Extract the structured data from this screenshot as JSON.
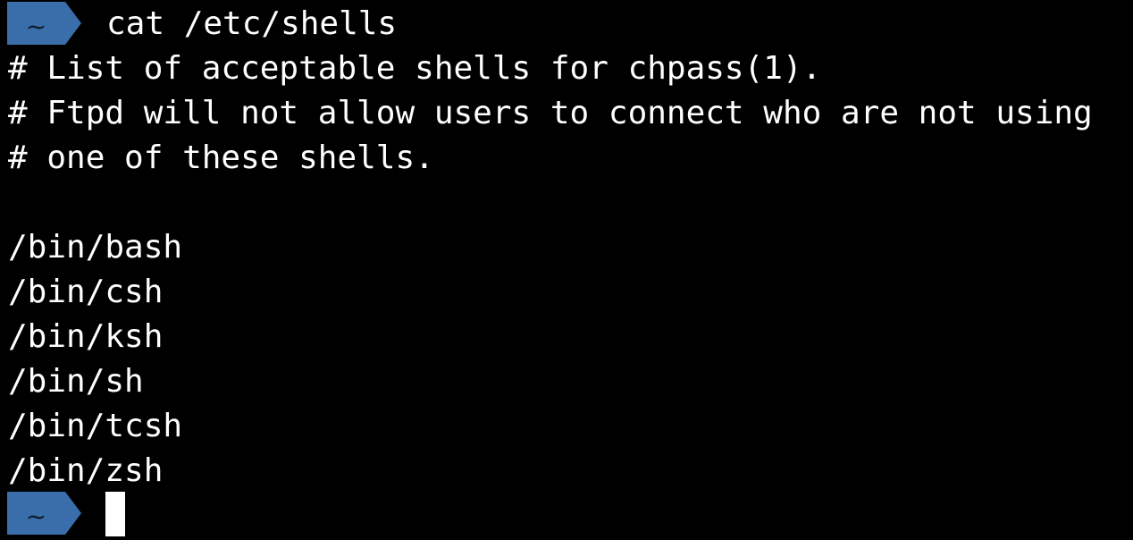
{
  "terminal": {
    "prompt_symbol": "~",
    "command": "cat /etc/shells",
    "output": [
      "# List of acceptable shells for chpass(1).",
      "# Ftpd will not allow users to connect who are not using",
      "# one of these shells.",
      "",
      "/bin/bash",
      "/bin/csh",
      "/bin/ksh",
      "/bin/sh",
      "/bin/tcsh",
      "/bin/zsh"
    ],
    "colors": {
      "background": "#000000",
      "foreground": "#ffffff",
      "prompt_segment": "#3a6eaa"
    }
  }
}
